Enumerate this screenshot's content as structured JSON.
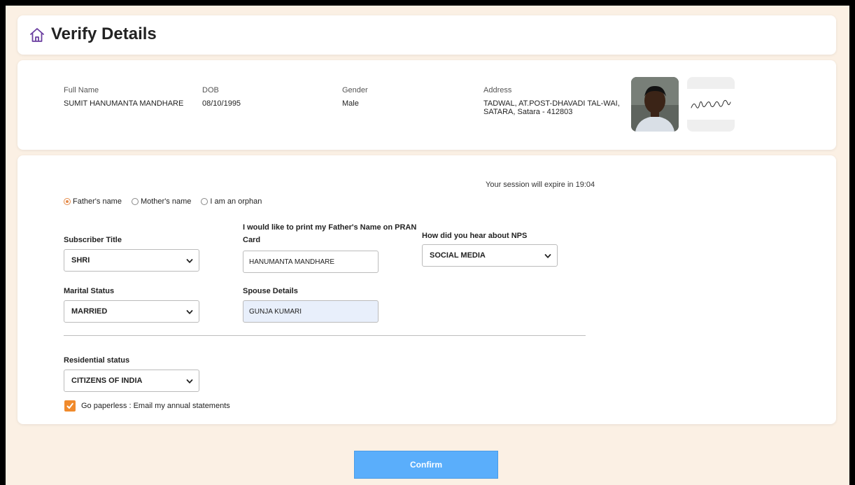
{
  "header": {
    "title": "Verify Details"
  },
  "subscriber": {
    "full_name_label": "Full Name",
    "full_name": "SUMIT HANUMANTA MANDHARE",
    "dob_label": "DOB",
    "dob": "08/10/1995",
    "gender_label": "Gender",
    "gender": "Male",
    "address_label": "Address",
    "address_line1": "TADWAL, AT.POST-DHAVADI TAL-WAI,",
    "address_line2": "SATARA, Satara - 412803"
  },
  "session": {
    "text": "Your session will expire in 19:04"
  },
  "parent_options": [
    {
      "label": "Father's name",
      "selected": true
    },
    {
      "label": "Mother's name",
      "selected": false
    },
    {
      "label": "I am an orphan",
      "selected": false
    }
  ],
  "form": {
    "subscriber_title_label": "Subscriber Title",
    "subscriber_title_value": "SHRI",
    "print_name_label_1": "I would like to print my Father's Name on PRAN",
    "print_name_label_2": "Card",
    "print_name_value": "HANUMANTA MANDHARE",
    "nps_source_label": "How did you hear about NPS",
    "nps_source_value": "SOCIAL MEDIA",
    "marital_status_label": "Marital Status",
    "marital_status_value": "MARRIED",
    "spouse_label": "Spouse Details",
    "spouse_value": "GUNJA KUMARI",
    "residential_label": "Residential status",
    "residential_value": "CITIZENS OF INDIA",
    "paperless_label": "Go paperless : Email my annual statements",
    "paperless_checked": true
  },
  "actions": {
    "confirm_label": "Confirm"
  },
  "colors": {
    "accent": "#f08a2c",
    "confirm_button": "#5aaefb",
    "page_background": "#fbf0e4",
    "spouse_input_fill": "#e8effb"
  },
  "icons": {
    "home": "home-icon",
    "chevron": "chevron-down-icon",
    "checkbox": "check-icon"
  }
}
